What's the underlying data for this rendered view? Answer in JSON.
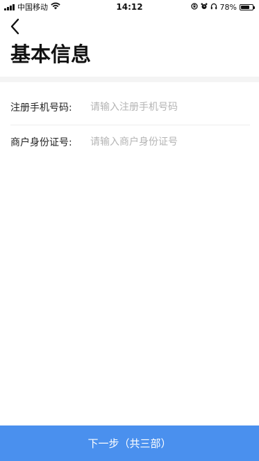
{
  "status_bar": {
    "carrier": "中国移动",
    "time": "14:12",
    "battery_percent": "78%",
    "battery_level": 0.78,
    "icons": [
      "signal-icon",
      "wifi-icon",
      "orientation-lock-icon",
      "alarm-icon",
      "headphones-icon",
      "battery-icon"
    ]
  },
  "header": {
    "back_icon": "chevron-left-icon",
    "title": "基本信息"
  },
  "form": {
    "phone": {
      "label": "注册手机号码:",
      "value": "",
      "placeholder": "请输入注册手机号码"
    },
    "id_card": {
      "label": "商户身份证号:",
      "value": "",
      "placeholder": "请输入商户身份证号"
    }
  },
  "footer": {
    "next_label": "下一步（共三部）"
  },
  "colors": {
    "accent": "#4a90ee",
    "placeholder": "#b4b4b4",
    "divider": "#f4f4f4"
  }
}
